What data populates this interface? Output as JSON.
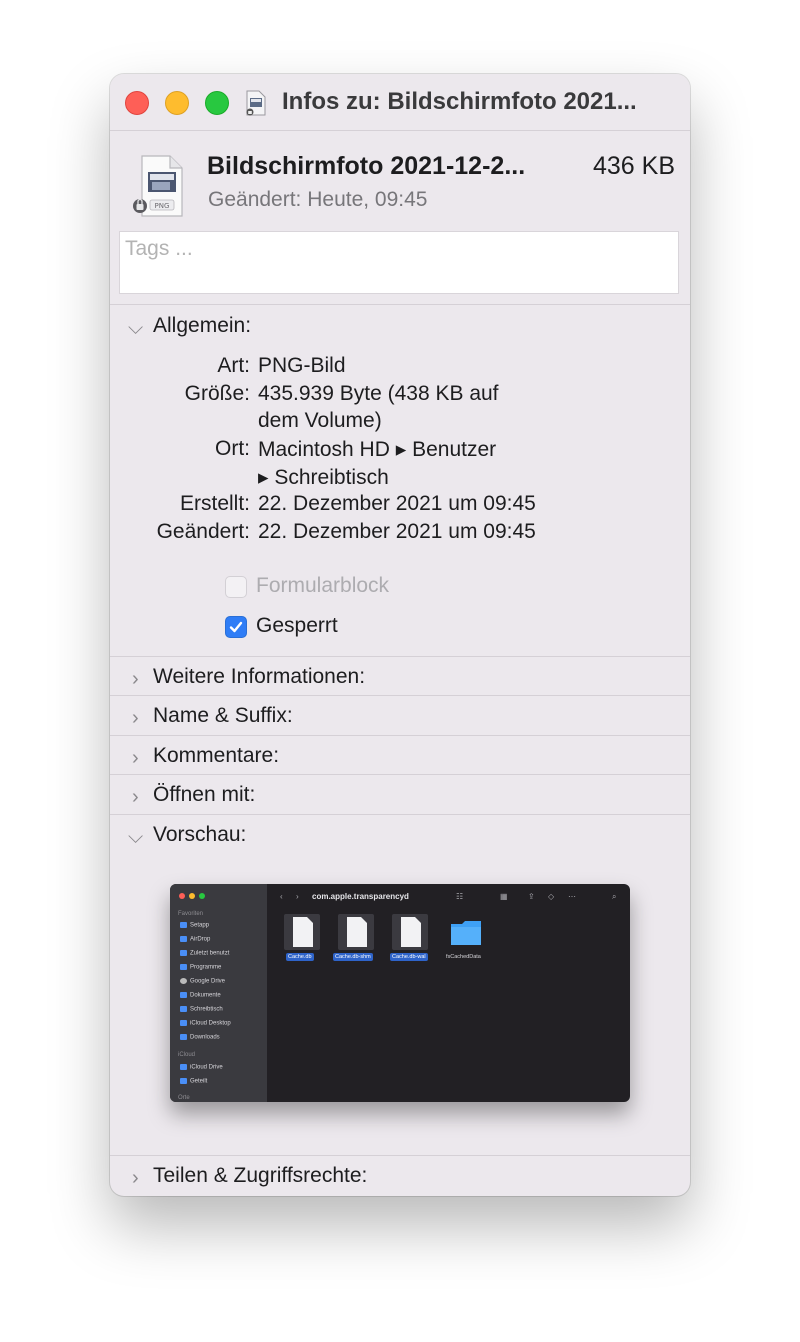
{
  "window": {
    "title": "Infos zu: Bildschirmfoto 2021...",
    "controls": [
      "close",
      "minimize",
      "zoom"
    ]
  },
  "file": {
    "name": "Bildschirmfoto 2021-12-2...",
    "size": "436 KB",
    "modified": "Geändert: Heute, 09:45",
    "icon_badge": "PNG"
  },
  "tags": {
    "placeholder": "Tags ..."
  },
  "sections": {
    "general": "Allgemein:",
    "more_info": "Weitere Informationen:",
    "name_suffix": "Name & Suffix:",
    "comments": "Kommentare:",
    "open_with": "Öffnen mit:",
    "preview": "Vorschau:",
    "sharing": "Teilen & Zugriffsrechte:"
  },
  "general": {
    "kind_label": "Art:",
    "kind_value": "PNG-Bild",
    "size_label": "Größe:",
    "size_value_1": "435.939 Byte (438 KB auf",
    "size_value_2": "dem Volume)",
    "where_label": "Ort:",
    "where_value_1": "Macintosh HD ▸ Benutzer",
    "where_value_2": "▸ Schreibtisch",
    "created_label": "Erstellt:",
    "created_value": "22. Dezember 2021 um 09:45",
    "modified_label": "Geändert:",
    "modified_value": "22. Dezember 2021 um 09:45",
    "stationery_label": "Formularblock",
    "stationery_checked": false,
    "stationery_enabled": false,
    "locked_label": "Gesperrt",
    "locked_checked": true
  },
  "preview": {
    "folder_title": "com.apple.transparencyd",
    "sidebar_sections": [
      "Favoriten",
      "iCloud",
      "Orte"
    ],
    "sidebar_items": [
      "Setapp",
      "AirDrop",
      "Zuletzt benutzt",
      "Programme",
      "Google Drive",
      "Dokumente",
      "Schreibtisch",
      "iCloud Desktop",
      "Downloads"
    ],
    "icloud_items": [
      "iCloud Drive",
      "Geteilt"
    ],
    "files": [
      "Cache.db",
      "Cache.db-shm",
      "Cache.db-wal",
      "fsCachedData"
    ]
  },
  "colors": {
    "window_bg": "#ece8ed",
    "checkbox_accent": "#2f7df6",
    "close": "#fe5f57",
    "minimize": "#febc2e",
    "zoom": "#28c840"
  }
}
